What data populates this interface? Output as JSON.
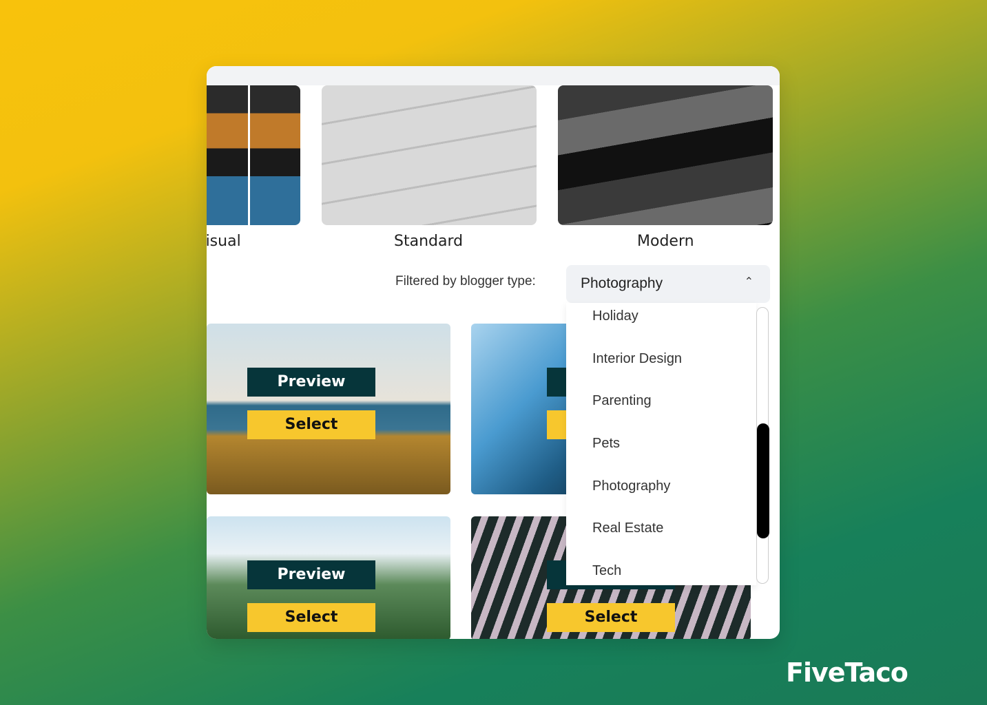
{
  "templates": [
    {
      "label": "Visual"
    },
    {
      "label": "Standard"
    },
    {
      "label": "Modern"
    }
  ],
  "filter": {
    "label": "Filtered by blogger type:",
    "selected": "Photography",
    "options": [
      "Holiday",
      "Interior Design",
      "Parenting",
      "Pets",
      "Photography",
      "Real Estate",
      "Tech"
    ]
  },
  "cards": {
    "preview_label": "Preview",
    "select_label": "Select"
  },
  "brand": {
    "logo": "FiveTaco"
  },
  "colors": {
    "preview_bg": "#06353a",
    "select_bg": "#f7c72d"
  }
}
